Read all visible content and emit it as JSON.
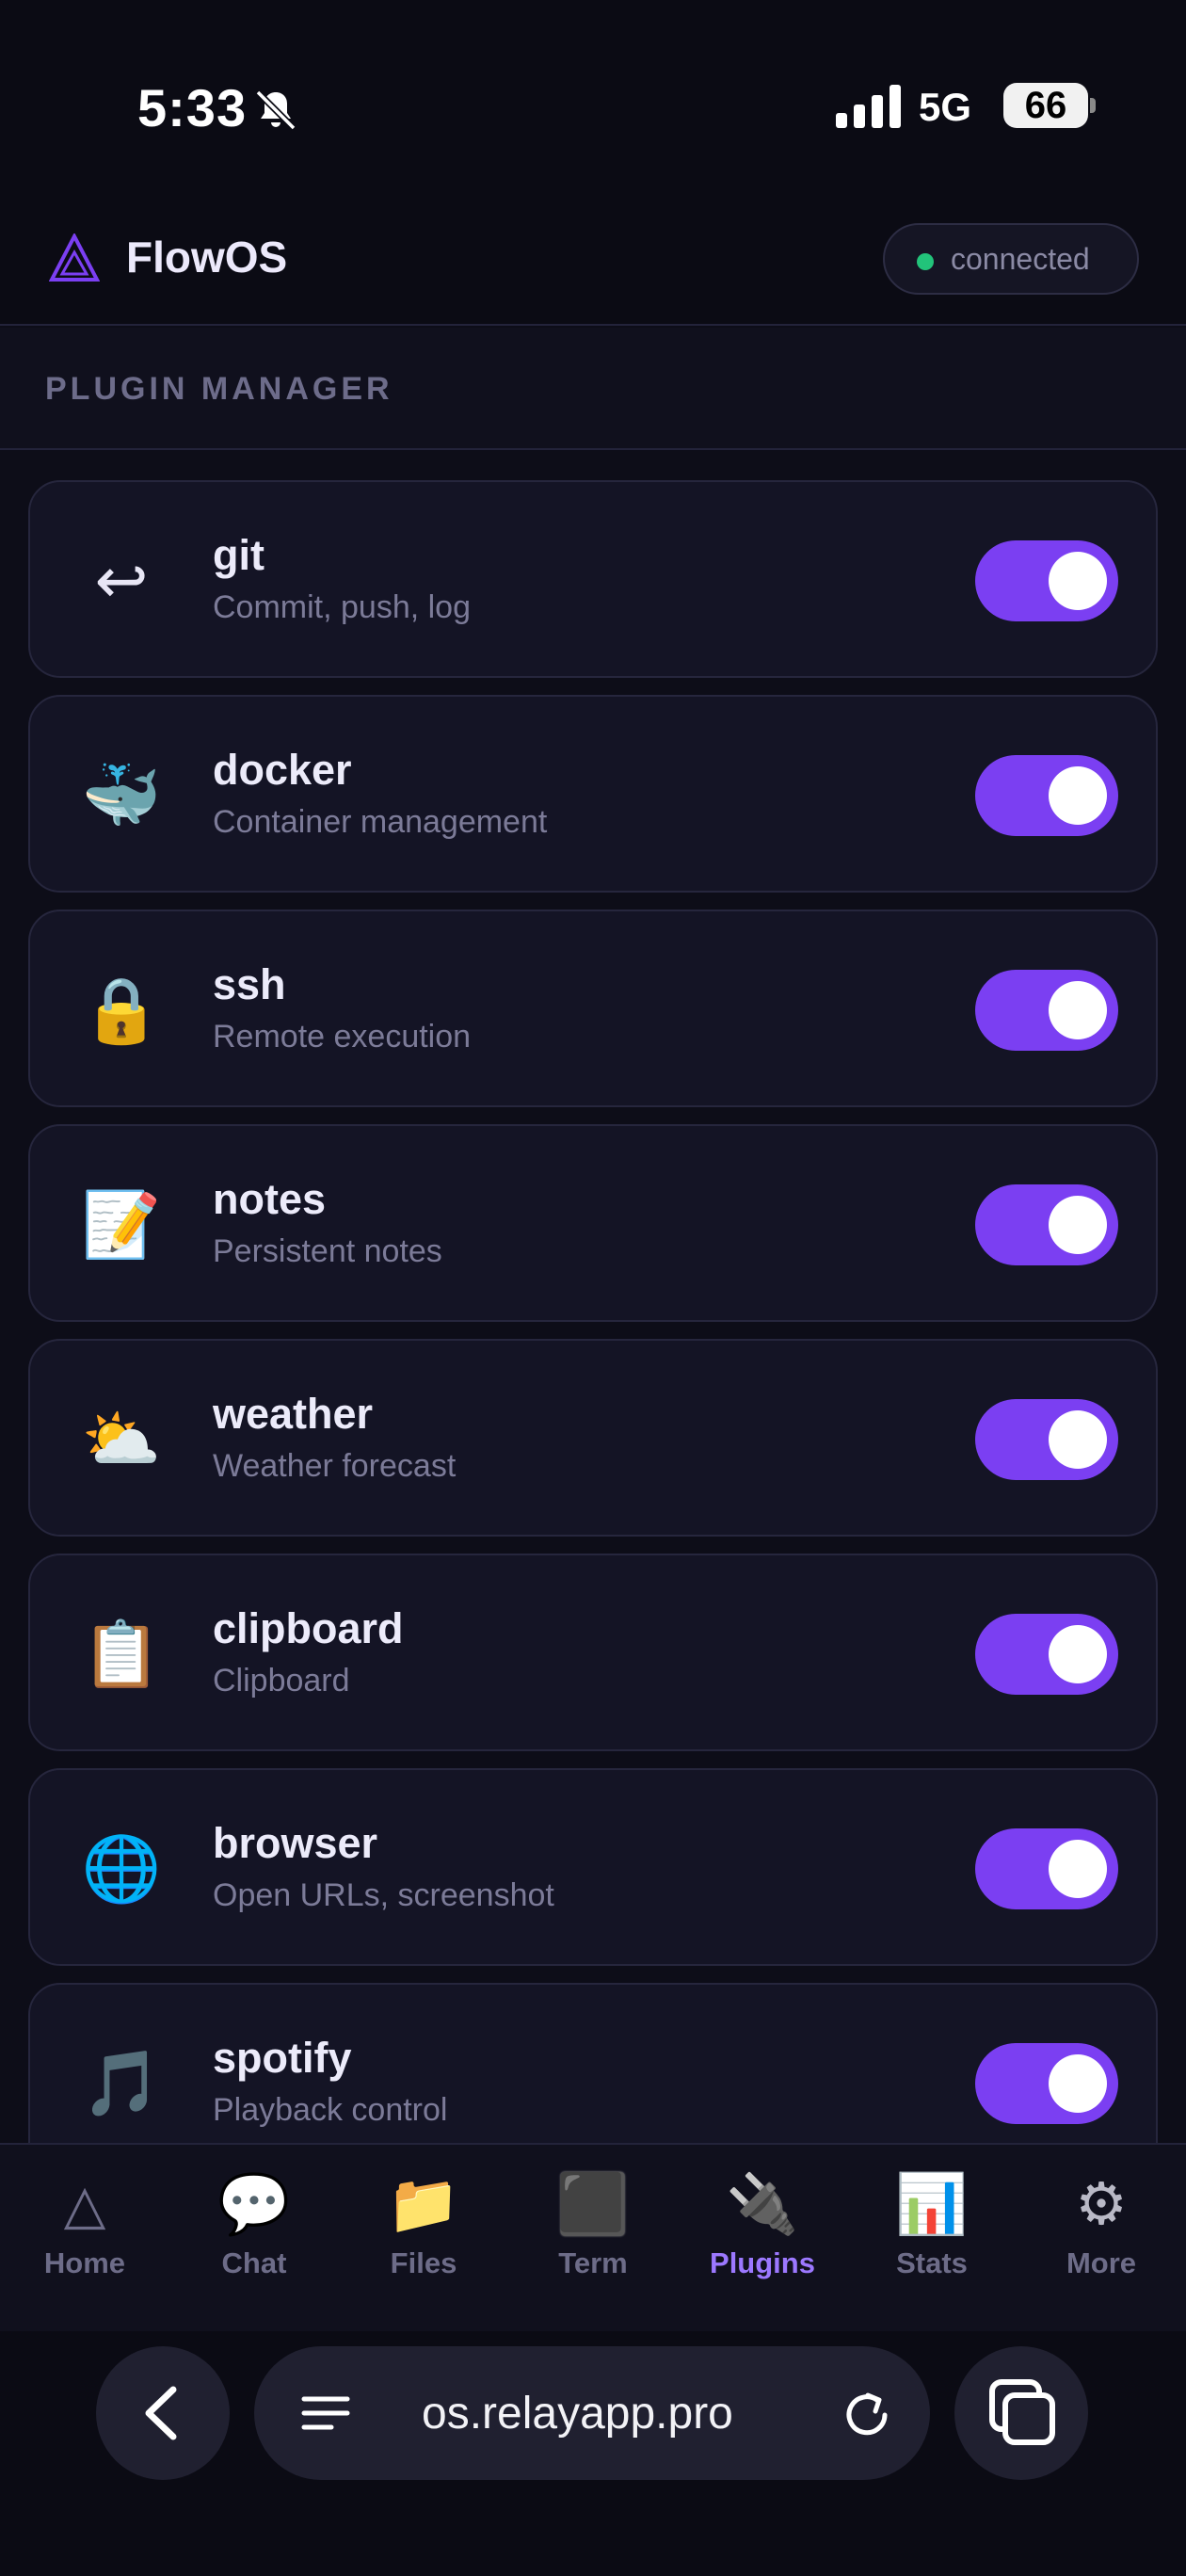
{
  "status": {
    "time": "5:33",
    "network": "5G",
    "battery": "66"
  },
  "header": {
    "app_name": "FlowOS",
    "connection_status": "connected"
  },
  "section": {
    "title": "PLUGIN MANAGER"
  },
  "plugins": [
    {
      "name": "git",
      "description": "Commit, push, log",
      "icon": "↩",
      "enabled": true
    },
    {
      "name": "docker",
      "description": "Container management",
      "icon": "🐳",
      "enabled": true
    },
    {
      "name": "ssh",
      "description": "Remote execution",
      "icon": "🔒",
      "enabled": true
    },
    {
      "name": "notes",
      "description": "Persistent notes",
      "icon": "📝",
      "enabled": true
    },
    {
      "name": "weather",
      "description": "Weather forecast",
      "icon": "⛅",
      "enabled": true
    },
    {
      "name": "clipboard",
      "description": "Clipboard",
      "icon": "📋",
      "enabled": true
    },
    {
      "name": "browser",
      "description": "Open URLs, screenshot",
      "icon": "🌐",
      "enabled": true
    },
    {
      "name": "spotify",
      "description": "Playback control",
      "icon": "🎵",
      "enabled": true
    }
  ],
  "tabs": [
    {
      "label": "Home",
      "icon": "△"
    },
    {
      "label": "Chat",
      "icon": "💬"
    },
    {
      "label": "Files",
      "icon": "📁"
    },
    {
      "label": "Term",
      "icon": "⬛"
    },
    {
      "label": "Plugins",
      "icon": "🔌",
      "active": true
    },
    {
      "label": "Stats",
      "icon": "📊"
    },
    {
      "label": "More",
      "icon": "⚙"
    }
  ],
  "browser": {
    "url": "os.relayapp.pro"
  },
  "colors": {
    "accent": "#7b3ff2",
    "active_tab": "#9c78ff",
    "connected_dot": "#22c37a",
    "background": "#0d0d18"
  }
}
